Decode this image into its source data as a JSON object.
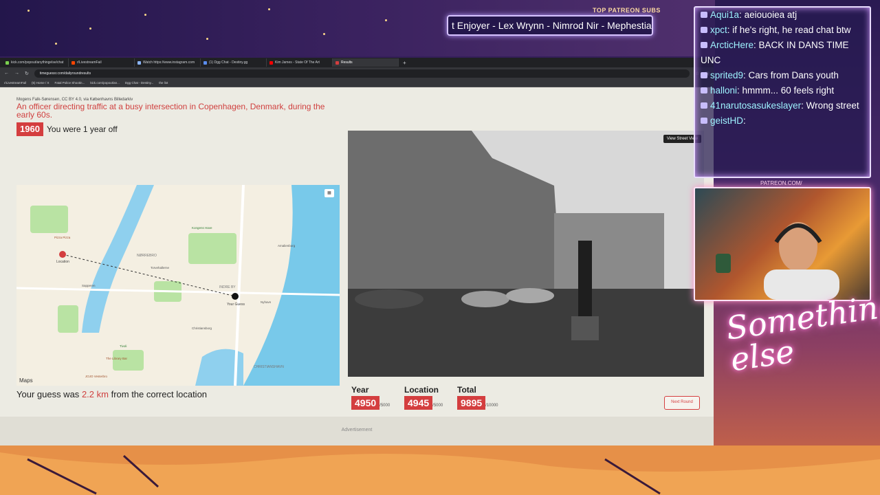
{
  "overlay": {
    "patreon_label": "TOP PATREON SUBS",
    "marquee": "t Enjoyer - Lex Wrynn - Nimrod Nir - Mephestia"
  },
  "browser": {
    "tabs": [
      {
        "label": "kick.com/popout/anythingelse/chat",
        "active": false
      },
      {
        "label": "r/LivestreamFail",
        "active": false
      },
      {
        "label": "Watch https://www.instagram.com",
        "active": false
      },
      {
        "label": "(1) Dgg Chat - Destiny.gg",
        "active": false
      },
      {
        "label": "Kim James - State Of The Art",
        "active": false
      },
      {
        "label": "Results",
        "active": true
      }
    ],
    "url": "timeguessr.com/dailyroundresults",
    "bookmarks": [
      "r/LivestreamFail",
      "(5) Home / X",
      "Fatal Police Shootin...",
      "kick.com/popout/an...",
      "Dgg Chat - Destiny...",
      "the list"
    ]
  },
  "result": {
    "credit": "Mogens Falk-Sørensen, CC BY 4.0, via Københavns Billedarkiv",
    "description": "An officer directing traffic at a busy intersection in Copenhagen, Denmark, during the early 60s.",
    "year": "1960",
    "year_off": "You were 1 year off",
    "guess_prefix": "Your guess was",
    "guess_distance": "2.2 km",
    "guess_suffix": "from the correct location",
    "map_brand": "Maps",
    "map_labels": {
      "norrebro": "NØRREBRO",
      "indre_by": "INDRE BY",
      "christianshavn": "CHRISTIANSHAVN",
      "location": "Location",
      "your_guess": "Your Guess",
      "pizza": "Pizza Pizza",
      "torvehallerne": "Torvehallerne",
      "kongens_have": "Kongens Have",
      "tivoli": "Tivoli",
      "library_bar": "The Library Bar",
      "jojo": "JOJO Vesterbro",
      "nyhavn": "Nyhavn",
      "christiansborg": "Christiansborg",
      "amalienborg": "Amalienborg",
      "sapperen": "Sapperen"
    },
    "street_view_label": "View Street View",
    "scores": [
      {
        "label": "Year",
        "value": "4950",
        "max": "/5000"
      },
      {
        "label": "Location",
        "value": "4945",
        "max": "/5000"
      },
      {
        "label": "Total",
        "value": "9895",
        "max": "/10000"
      }
    ],
    "next_round": "Next Round",
    "advertisement": "Advertisement"
  },
  "chat": {
    "messages": [
      {
        "user": "Aqui1a",
        "text": "aeiouoiea atj"
      },
      {
        "user": "xpct",
        "text": "if he's right, he read chat btw"
      },
      {
        "user": "ArcticHere",
        "text": "BACK IN DANS TIME UNC"
      },
      {
        "user": "sprited9",
        "text": "Cars from Dans youth"
      },
      {
        "user": "halloni",
        "text": "hmmm... 60 feels right"
      },
      {
        "user": "41narutosasukeslayer",
        "text": "Wrong street"
      },
      {
        "user": "geistHD",
        "text": ""
      }
    ]
  },
  "branding": {
    "patreon_url": "PATREON.COM/",
    "neon_text": "Something else"
  },
  "colors": {
    "accent": "#d43e3f",
    "chat_user": "#9ef2ff"
  }
}
